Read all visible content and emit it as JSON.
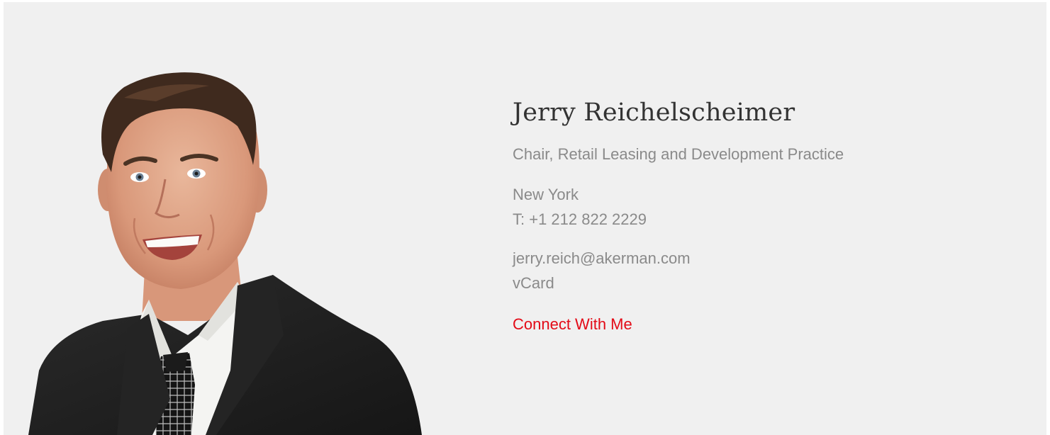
{
  "profile": {
    "name": "Jerry Reichelscheimer",
    "title": "Chair, Retail Leasing and Development Practice",
    "office": "New York",
    "phone": "T: +1 212 822 2229",
    "email": "jerry.reich@akerman.com",
    "vcard_label": "vCard",
    "connect_label": "Connect With Me"
  },
  "colors": {
    "background": "#f0f0f0",
    "name_text": "#333333",
    "secondary_text": "#8a8a8a",
    "accent": "#e30b17"
  }
}
